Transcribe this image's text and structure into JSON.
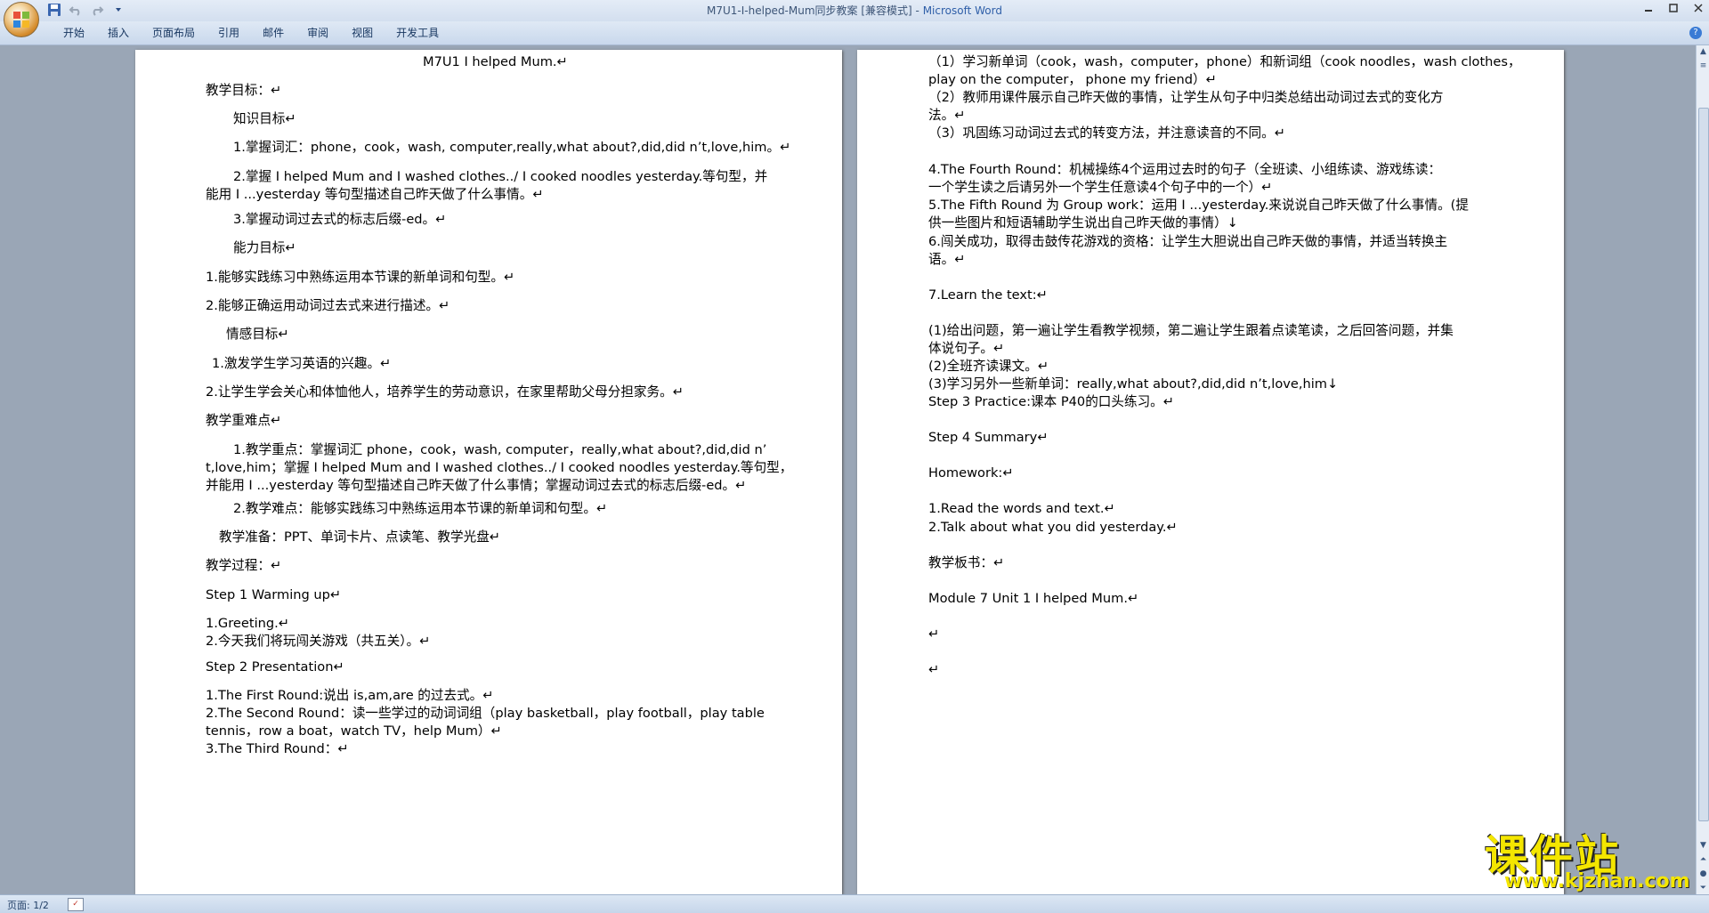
{
  "window": {
    "title": "M7U1-I-helped-Mum同步教案 [兼容模式]",
    "app_name": "Microsoft Word"
  },
  "qat": {
    "save_icon": "save-icon",
    "undo_icon": "undo-icon",
    "redo_icon": "redo-icon",
    "customize_icon": "chevron-down-icon"
  },
  "ribbon": {
    "tabs": [
      "开始",
      "插入",
      "页面布局",
      "引用",
      "邮件",
      "审阅",
      "视图",
      "开发工具"
    ]
  },
  "page1": {
    "lines": [
      "M7U1 I helped Mum.↵",
      "教学目标：↵",
      "知识目标↵",
      "1.掌握词汇：phone，cook，wash, computer,really,what about?,did,did n’t,love,him。↵",
      "2.掌握 I helped Mum and I washed clothes../ I cooked noodles yesterday.等句型，并",
      "能用 I ...yesterday  等句型描述自己昨天做了什么事情。↵",
      "3.掌握动词过去式的标志后缀-ed。↵",
      "能力目标↵",
      "1.能够实践练习中熟练运用本节课的新单词和句型。↵",
      "2.能够正确运用动词过去式来进行描述。↵",
      "情感目标↵",
      "1.激发学生学习英语的兴趣。↵",
      "2.让学生学会关心和体恤他人，培养学生的劳动意识，在家里帮助父母分担家务。↵",
      "教学重难点↵",
      "1.教学重点：掌握词汇 phone，cook，wash, computer，really,what about?,did,did n’",
      "t,love,him；掌握 I helped Mum and I washed clothes../ I cooked noodles yesterday.等句型，",
      "并能用 I ...yesterday  等句型描述自己昨天做了什么事情；掌握动词过去式的标志后缀-ed。↵",
      "2.教学难点：能够实践练习中熟练运用本节课的新单词和句型。↵",
      "教学准备：PPT、单词卡片、点读笔、教学光盘↵",
      "教学过程：↵",
      "Step 1 Warming up↵",
      "1.Greeting.↵",
      "2.今天我们将玩闯关游戏（共五关）。↵",
      "Step 2 Presentation↵",
      "1.The    First    Round:说出 is,am,are 的过去式。↵",
      "2.The    Second    Round：读一些学过的动词词组（play basketball，play football，play table",
      "tennis，row a boat，watch TV，help Mum）↵",
      "3.The    Third    Round：↵"
    ]
  },
  "page2": {
    "lines": [
      "（1）学习新单词（cook，wash，computer，phone）和新词组（cook noodles，wash clothes，",
      "play on the computer，  phone my friend）↵",
      "（2）教师用课件展示自己昨天做的事情，让学生从句子中归类总结出动词过去式的变化方",
      "法。↵",
      "（3）巩固练习动词过去式的转变方法，并注意读音的不同。↵",
      "4.The    Fourth    Round：机械操练4个运用过去时的句子（全班读、小组练读、游戏练读：",
      "一个学生读之后请另外一个学生任意读4个句子中的一个）↵",
      "5.The    Fifth    Round 为 Group work：运用 I ...yesterday.来说说自己昨天做了什么事情。(提",
      "供一些图片和短语辅助学生说出自己昨天做的事情）↓",
      "6.闯关成功，取得击鼓传花游戏的资格：让学生大胆说出自己昨天做的事情，并适当转换主",
      "语。↵",
      "7.Learn the text:↵",
      "(1)给出问题，第一遍让学生看教学视频，第二遍让学生跟着点读笔读，之后回答问题，并集",
      "体说句子。↵",
      "(2)全班齐读课文。↵",
      "(3)学习另外一些新单词：really,what about?,did,did n’t,love,him↓",
      "Step 3 Practice:课本 P40的口头练习。↵",
      "Step 4 Summary↵",
      "Homework:↵",
      "1.Read the words and text.↵",
      "2.Talk about what you did yesterday.↵",
      "教学板书：↵",
      "Module 7 Unit 1  I helped Mum.↵",
      "↵",
      "↵"
    ]
  },
  "statusbar": {
    "pages": "页面: 1/2"
  },
  "watermark": {
    "text": "课件站",
    "url": "www.kjzhan.com"
  }
}
